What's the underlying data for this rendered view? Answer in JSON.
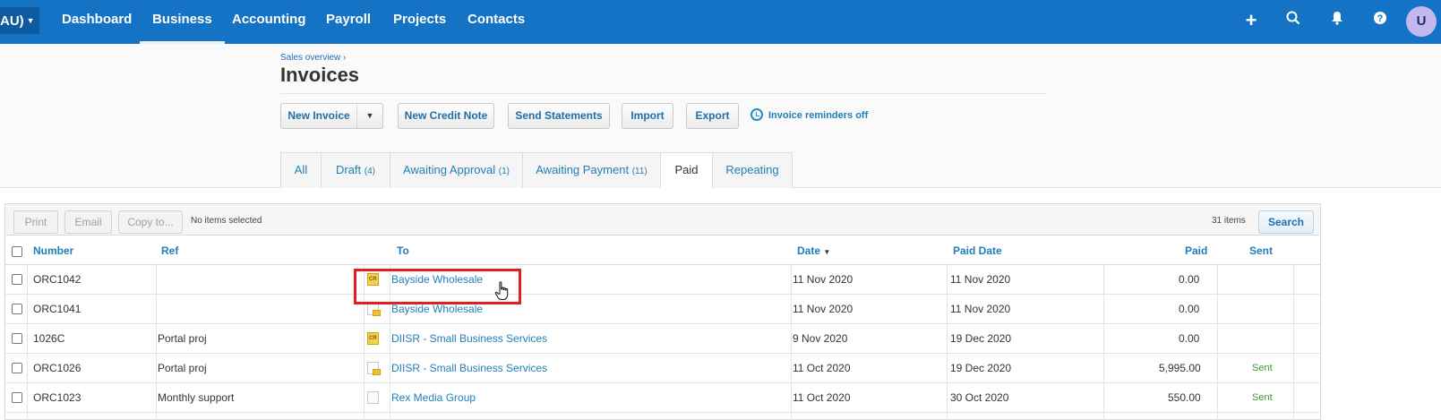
{
  "nav": {
    "org_label": "AU)",
    "items": [
      "Dashboard",
      "Business",
      "Accounting",
      "Payroll",
      "Projects",
      "Contacts"
    ],
    "active": "Business",
    "icons": [
      "plus-icon",
      "search-icon",
      "bell-icon",
      "help-icon"
    ],
    "avatar": "U"
  },
  "header": {
    "breadcrumb": "Sales overview ›",
    "title": "Invoices"
  },
  "actions": {
    "new_invoice": "New Invoice",
    "new_credit_note": "New Credit Note",
    "send_statements": "Send Statements",
    "import": "Import",
    "export": "Export",
    "reminders": "Invoice reminders off"
  },
  "tabs": [
    {
      "label": "All",
      "count": ""
    },
    {
      "label": "Draft",
      "count": "(4)"
    },
    {
      "label": "Awaiting Approval",
      "count": "(1)"
    },
    {
      "label": "Awaiting Payment",
      "count": "(11)"
    },
    {
      "label": "Paid",
      "count": ""
    },
    {
      "label": "Repeating",
      "count": ""
    }
  ],
  "active_tab": "Paid",
  "toolbar": {
    "print": "Print",
    "email": "Email",
    "copy_to": "Copy to...",
    "selection": "No items selected",
    "count": "31 items",
    "search": "Search"
  },
  "table": {
    "columns": {
      "number": "Number",
      "ref": "Ref",
      "to": "To",
      "date": "Date",
      "paid_date": "Paid Date",
      "paid": "Paid",
      "sent": "Sent"
    },
    "rows": [
      {
        "number": "ORC1042",
        "ref": "",
        "icon": "credit-note",
        "to": "Bayside Wholesale",
        "date": "11 Nov 2020",
        "paid_date": "11 Nov 2020",
        "paid": "0.00",
        "sent": ""
      },
      {
        "number": "ORC1041",
        "ref": "",
        "icon": "invoice-sent",
        "to": "Bayside Wholesale",
        "date": "11 Nov 2020",
        "paid_date": "11 Nov 2020",
        "paid": "0.00",
        "sent": ""
      },
      {
        "number": "1026C",
        "ref": "Portal proj",
        "icon": "credit-note",
        "to": "DIISR - Small Business Services",
        "date": "9 Nov 2020",
        "paid_date": "19 Dec 2020",
        "paid": "0.00",
        "sent": ""
      },
      {
        "number": "ORC1026",
        "ref": "Portal proj",
        "icon": "invoice-sent",
        "to": "DIISR - Small Business Services",
        "date": "11 Oct 2020",
        "paid_date": "19 Dec 2020",
        "paid": "5,995.00",
        "sent": "Sent"
      },
      {
        "number": "ORC1023",
        "ref": "Monthly support",
        "icon": "invoice",
        "to": "Rex Media Group",
        "date": "11 Oct 2020",
        "paid_date": "30 Oct 2020",
        "paid": "550.00",
        "sent": "Sent"
      }
    ]
  }
}
